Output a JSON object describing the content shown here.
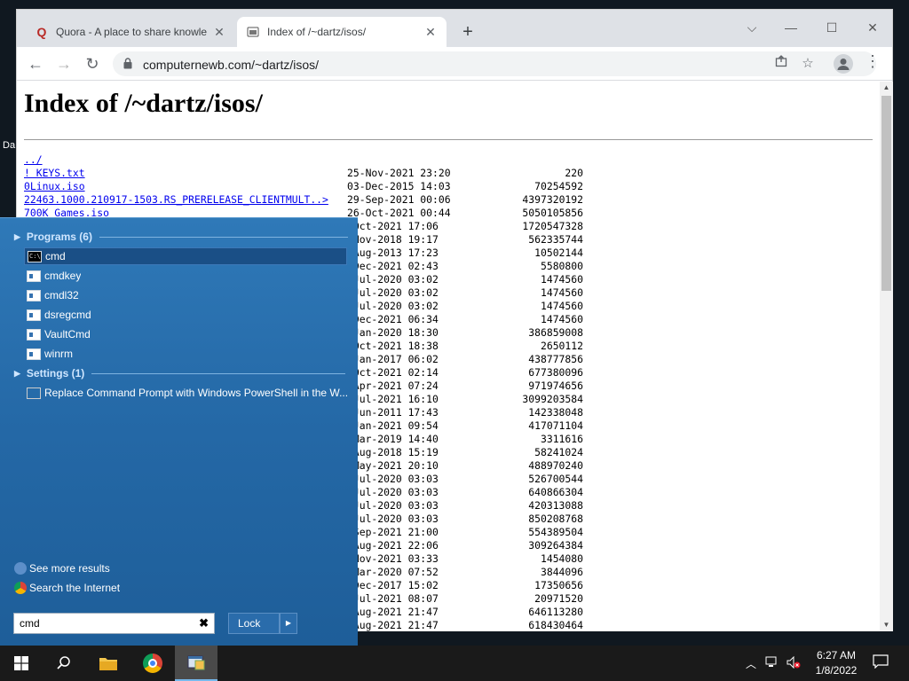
{
  "desktop": {
    "icon_label": "Da"
  },
  "browser": {
    "tabs": [
      {
        "title": "Quora - A place to share knowle",
        "favicon": "quora-icon"
      },
      {
        "title": "Index of /~dartz/isos/",
        "favicon": "folder-icon"
      }
    ],
    "new_tab": "+",
    "window_controls": {
      "tabsearch": "⌵",
      "minimize": "—",
      "maximize": "☐",
      "close": "✕"
    },
    "nav": {
      "back": "←",
      "forward": "→",
      "reload": "↻"
    },
    "url": "computernewb.com/~dartz/isos/",
    "star": "☆"
  },
  "page": {
    "heading": "Index of /~dartz/isos/",
    "parent_link": "../",
    "files": [
      {
        "name": "! KEYS.txt",
        "date": "25-Nov-2021 23:20",
        "size": "220"
      },
      {
        "name": "0Linux.iso",
        "date": "03-Dec-2015 14:03",
        "size": "70254592"
      },
      {
        "name": "22463.1000.210917-1503.RS_PRERELEASE_CLIENTMULT..>",
        "date": "29-Sep-2021 00:06",
        "size": "4397320192"
      },
      {
        "name": "700K Games.iso",
        "date": "26-Oct-2021 00:44",
        "size": "5050105856"
      },
      {
        "name": "",
        "date": "-Oct-2021 17:06",
        "size": "1720547328"
      },
      {
        "name": "",
        "date": "-Nov-2018 19:17",
        "size": "562335744"
      },
      {
        "name": "",
        "date": "-Aug-2013 17:23",
        "size": "10502144"
      },
      {
        "name": "",
        "date": "-Dec-2021 02:43",
        "size": "5580800"
      },
      {
        "name": "",
        "date": "-Jul-2020 03:02",
        "size": "1474560"
      },
      {
        "name": "",
        "date": "-Jul-2020 03:02",
        "size": "1474560"
      },
      {
        "name": "",
        "date": "-Jul-2020 03:02",
        "size": "1474560"
      },
      {
        "name": "",
        "date": "-Dec-2021 06:34",
        "size": "1474560"
      },
      {
        "name": "",
        "date": "-Jan-2020 18:30",
        "size": "386859008"
      },
      {
        "name": "",
        "date": "-Oct-2021 18:38",
        "size": "2650112"
      },
      {
        "name": "",
        "date": "-Jan-2017 06:02",
        "size": "438777856"
      },
      {
        "name": "",
        "date": "-Oct-2021 02:14",
        "size": "677380096"
      },
      {
        "name": "",
        "date": "-Apr-2021 07:24",
        "size": "971974656"
      },
      {
        "name": "",
        "date": "-Jul-2021 16:10",
        "size": "3099203584"
      },
      {
        "name": "",
        "date": "-Jun-2011 17:43",
        "size": "142338048"
      },
      {
        "name": "",
        "date": "-Jan-2021 09:54",
        "size": "417071104"
      },
      {
        "name": "",
        "date": "-Mar-2019 14:40",
        "size": "3311616"
      },
      {
        "name": "",
        "date": "-Aug-2018 15:19",
        "size": "58241024"
      },
      {
        "name": "",
        "date": "-May-2021 20:10",
        "size": "488970240"
      },
      {
        "name": "",
        "date": "-Jul-2020 03:03",
        "size": "526700544"
      },
      {
        "name": "",
        "date": "-Jul-2020 03:03",
        "size": "640866304"
      },
      {
        "name": "",
        "date": "-Jul-2020 03:03",
        "size": "420313088"
      },
      {
        "name": "",
        "date": "-Jul-2020 03:03",
        "size": "850208768"
      },
      {
        "name": "",
        "date": "-Sep-2021 21:00",
        "size": "554389504"
      },
      {
        "name": "",
        "date": "-Aug-2021 22:06",
        "size": "309264384"
      },
      {
        "name": "",
        "date": "-Nov-2021 03:33",
        "size": "1454080"
      },
      {
        "name": "",
        "date": "-Mar-2020 07:52",
        "size": "3844096"
      },
      {
        "name": "",
        "date": "-Dec-2017 15:02",
        "size": "17350656"
      },
      {
        "name": "",
        "date": "-Jul-2021 08:07",
        "size": "20971520"
      },
      {
        "name": "",
        "date": "-Aug-2021 21:47",
        "size": "646113280"
      },
      {
        "name": "",
        "date": "-Aug-2021 21:47",
        "size": "618430464"
      }
    ]
  },
  "start_menu": {
    "programs_header": "Programs (6)",
    "programs": [
      {
        "label": "cmd",
        "icon": "cmd-icon",
        "selected": true
      },
      {
        "label": "cmdkey",
        "icon": "app-icon"
      },
      {
        "label": "cmdl32",
        "icon": "dialer-icon"
      },
      {
        "label": "dsregcmd",
        "icon": "app-icon"
      },
      {
        "label": "VaultCmd",
        "icon": "app-icon"
      },
      {
        "label": "winrm",
        "icon": "script-icon"
      }
    ],
    "settings_header": "Settings (1)",
    "settings": [
      {
        "label": "Replace Command Prompt with Windows PowerShell in the W...",
        "icon": "settings-icon"
      }
    ],
    "see_more": "See more results",
    "search_internet": "Search the Internet",
    "search_value": "cmd",
    "clear": "✖",
    "lock_label": "Lock",
    "lock_arrow": "▶"
  },
  "taskbar": {
    "time": "6:27 AM",
    "date": "1/8/2022"
  }
}
